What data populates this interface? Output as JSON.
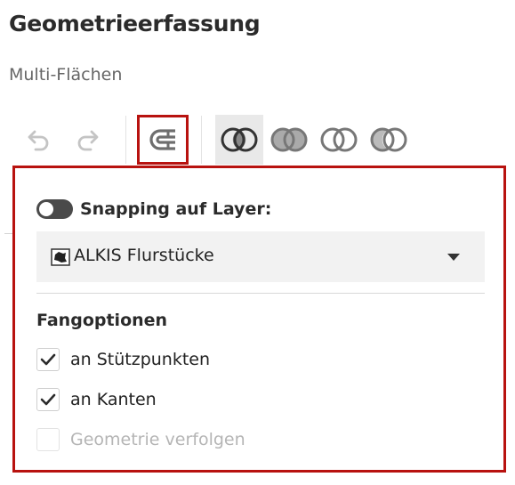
{
  "header": {
    "title": "Geometrieerfassung",
    "subtitle": "Multi-Flächen"
  },
  "toolbar": {
    "buttons": [
      {
        "name": "undo",
        "icon": "undo-icon"
      },
      {
        "name": "redo",
        "icon": "redo-icon"
      },
      {
        "name": "snapping",
        "icon": "magnet-icon",
        "highlighted": true
      },
      {
        "name": "union",
        "icon": "union-icon",
        "active": true
      },
      {
        "name": "intersection",
        "icon": "intersection-icon"
      },
      {
        "name": "difference",
        "icon": "difference-icon"
      },
      {
        "name": "symmetric-difference",
        "icon": "xor-icon"
      }
    ]
  },
  "snapping_panel": {
    "toggle_label": "Snapping auf Layer:",
    "toggle_on": false,
    "layer_select": {
      "selected": "ALKIS Flurstücke",
      "icon": "parcel-map-icon"
    },
    "section_title": "Fangoptionen",
    "options": [
      {
        "label": "an Stützpunkten",
        "checked": true,
        "disabled": false
      },
      {
        "label": "an Kanten",
        "checked": true,
        "disabled": false
      },
      {
        "label": "Geometrie verfolgen",
        "checked": false,
        "disabled": true
      }
    ]
  },
  "colors": {
    "highlight": "#b8120f",
    "active_bg": "#e9e9e9",
    "icon_dark": "#333333",
    "icon_muted": "#888888"
  }
}
